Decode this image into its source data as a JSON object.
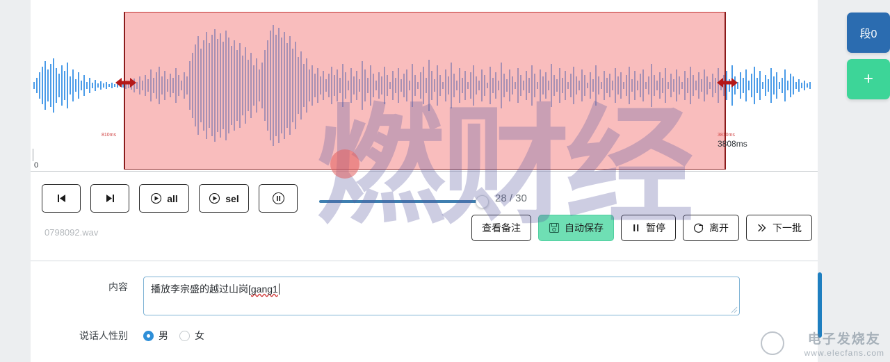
{
  "waveform": {
    "filename": "0798092.wav",
    "axis_origin": "0",
    "selection_start_label": "810ms",
    "selection_end_label_small": "3810ms",
    "selection_end_label_big": "3808ms",
    "wave_color": "#4a9be8",
    "selection_fill": "#f48787",
    "selection_border": "#8a1b1b",
    "handle_color": "#b51818"
  },
  "transport": {
    "skip_start_icon": "skip-to-start-icon",
    "skip_end_icon": "skip-to-end-icon",
    "play_all_label": "all",
    "play_sel_label": "sel",
    "pause_icon": "pause-circle-icon"
  },
  "progress": {
    "count_label": "28 / 30",
    "current": 28,
    "total": 30,
    "track_color": "#3f7fb0"
  },
  "actions": {
    "view_notes": "查看备注",
    "auto_save": "自动保存",
    "pause": "暂停",
    "leave": "离开",
    "next_batch": "下一批",
    "auto_save_color": "#6fdfb4"
  },
  "form": {
    "content_label": "内容",
    "content_value_normal": "播放李宗盛的越过山岗[",
    "content_value_misspelled": "gang1",
    "gender_label": "说话人性别",
    "gender_male": "男",
    "gender_female": "女",
    "gender_selected": "男"
  },
  "side_buttons": {
    "segment_label": "段0",
    "add_label": "+",
    "segment_color": "#2b6cb0",
    "add_color": "#3dd598"
  },
  "watermarks": {
    "center": "燃财经",
    "bottom_right_cn": "电子发烧友",
    "bottom_right_en": "www.elecfans.com"
  }
}
